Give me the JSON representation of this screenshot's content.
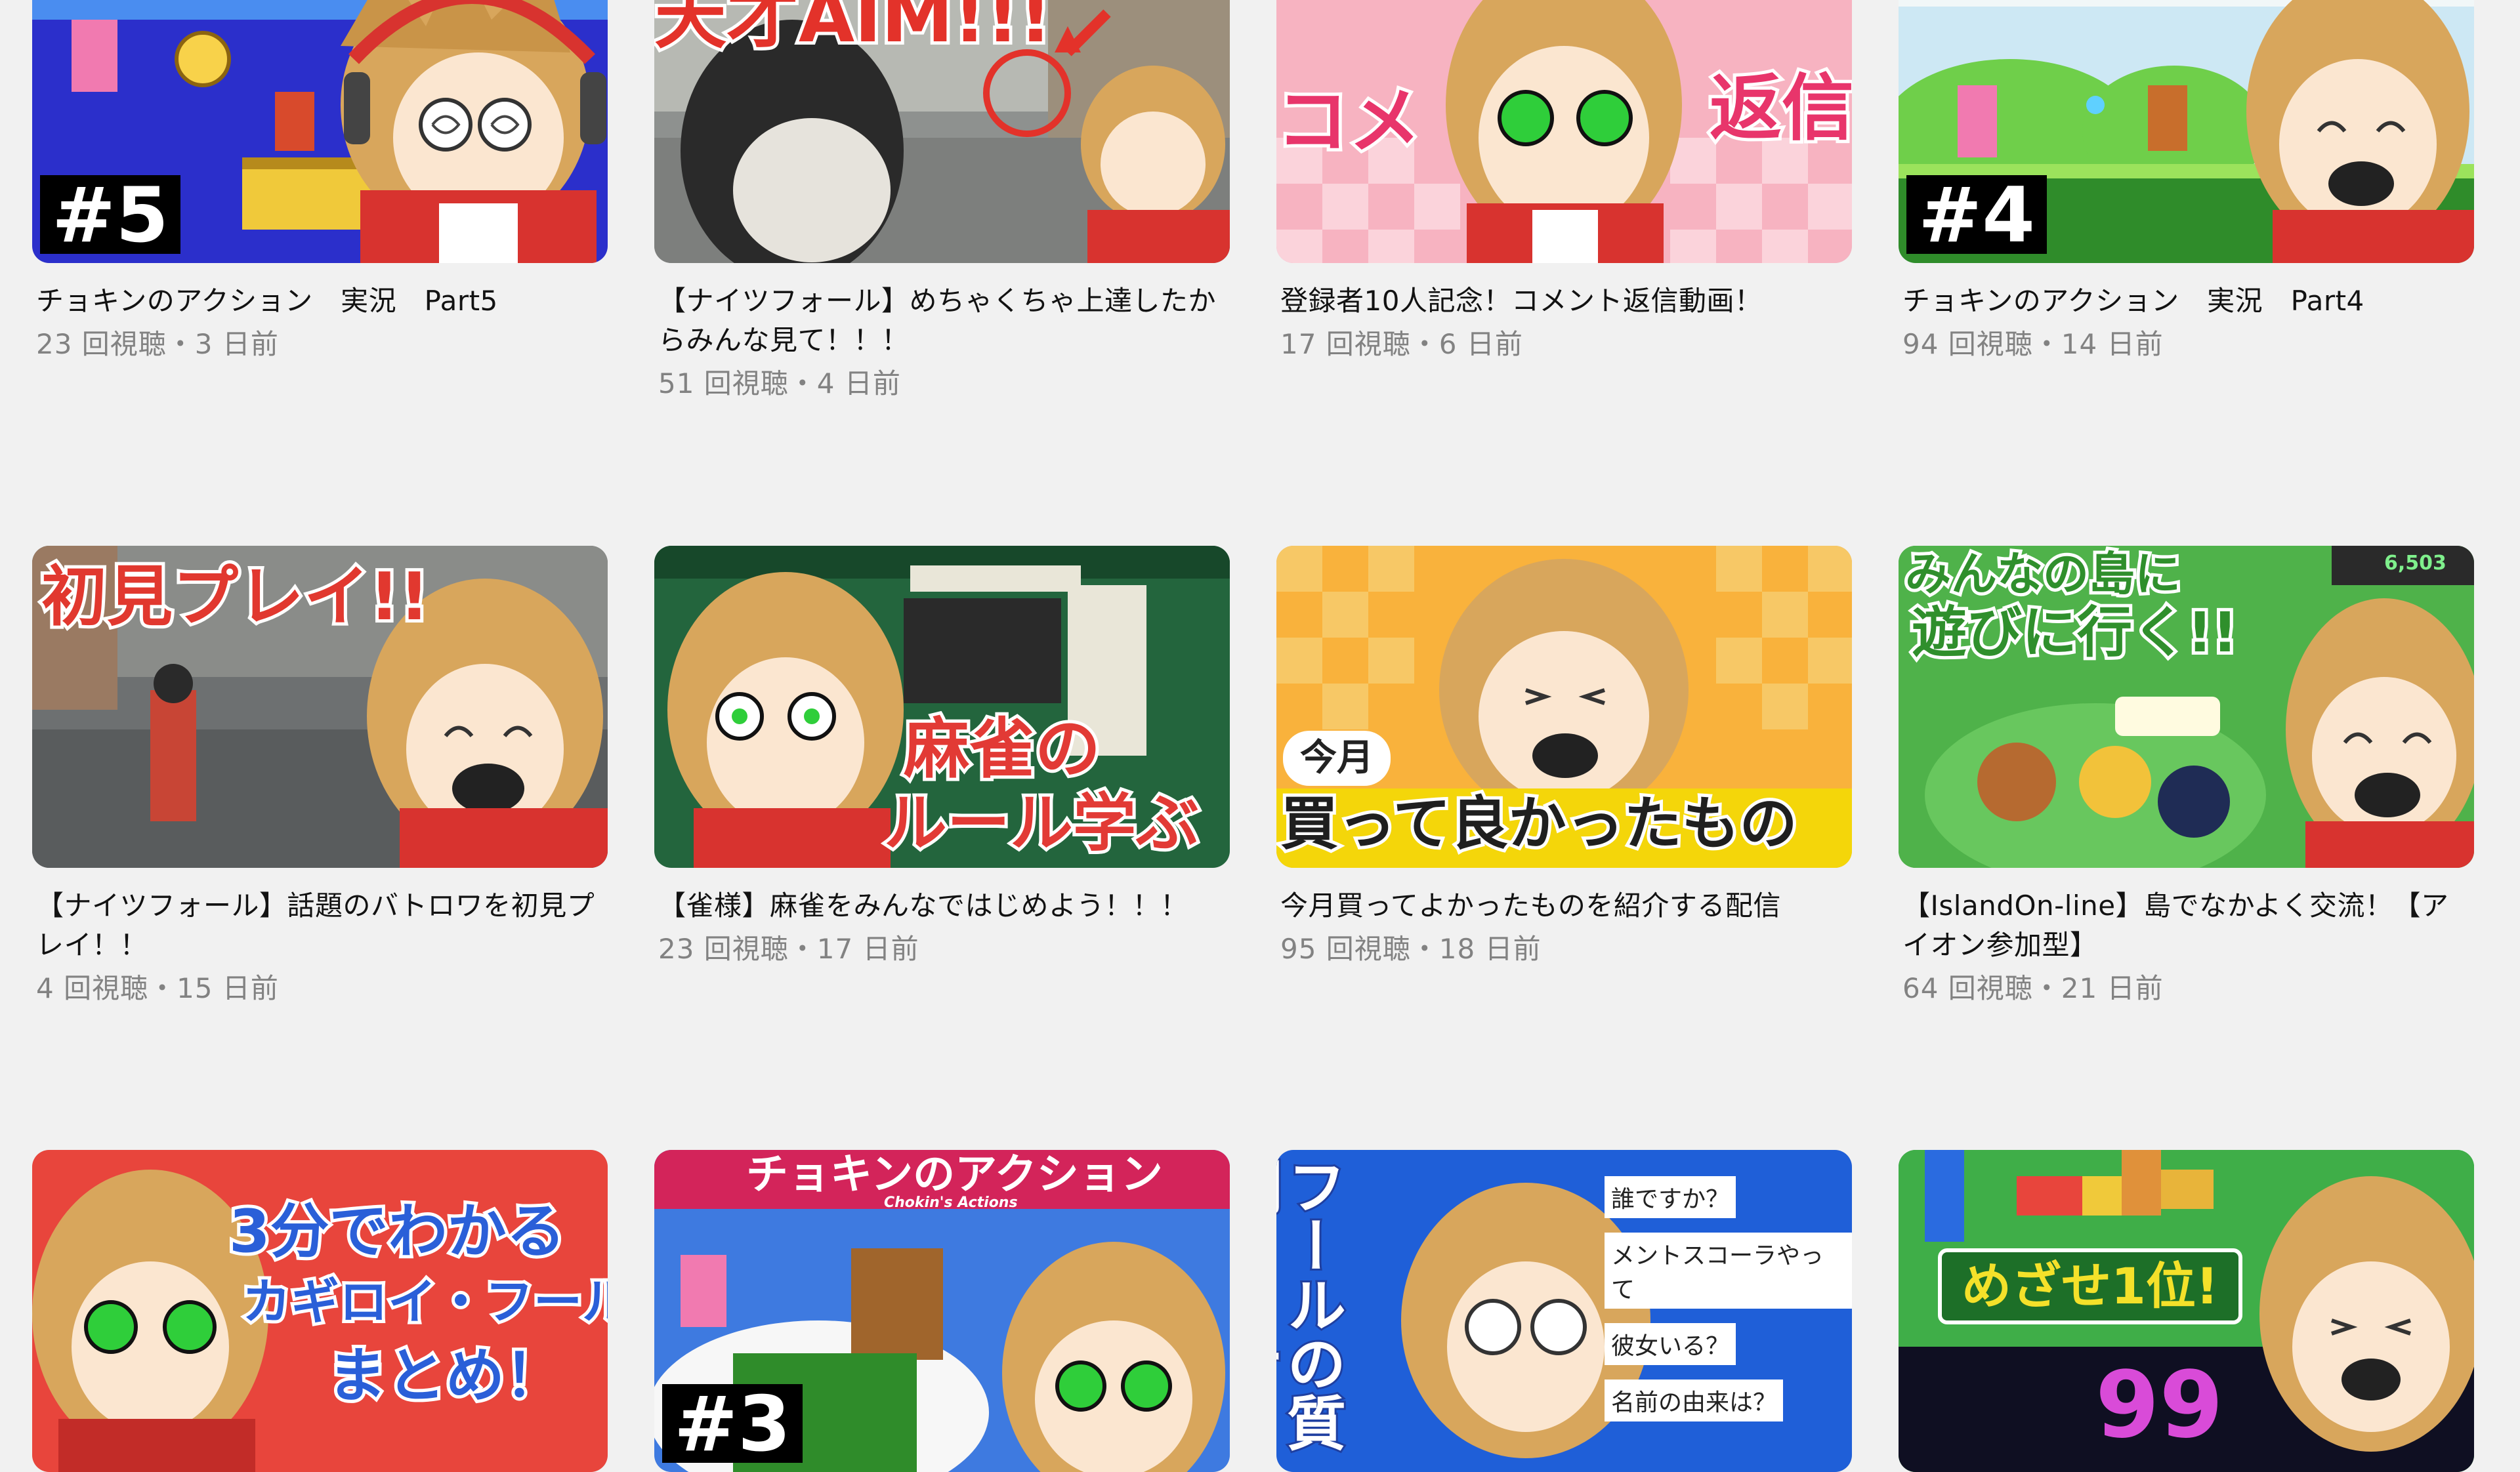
{
  "videos": [
    {
      "title": "チョキンのアクション　実況　Part5",
      "meta": "23 回視聴・3 日前",
      "thumb": {
        "style": "retro-blue",
        "badge": "#5",
        "colors": [
          "#3a3fd1",
          "#f0c93a",
          "#e8453c"
        ]
      }
    },
    {
      "title": "【ナイツフォール】めちゃくちゃ上達したからみんな見て！！！",
      "meta": "51 回視聴・4 日前",
      "thumb": {
        "style": "city-street",
        "overlay": "天才AIM!!!",
        "colors": [
          "#8d8f8c",
          "#e53a2f"
        ]
      }
    },
    {
      "title": "登録者10人記念！コメント返信動画！",
      "meta": "17 回視聴・6 日前",
      "thumb": {
        "style": "pink-check",
        "overlay_left": "コメ",
        "overlay_right": "返信",
        "colors": [
          "#f7a7b6",
          "#e8356b"
        ]
      }
    },
    {
      "title": "チョキンのアクション　実況　Part4",
      "meta": "94 回視聴・14 日前",
      "thumb": {
        "style": "retro-green",
        "badge": "#4",
        "colors": [
          "#6fcf4a",
          "#2f8c2a"
        ]
      }
    },
    {
      "title": "【ナイツフォール】話題のバトロワを初見プレイ！！",
      "meta": "4 回視聴・15 日前",
      "thumb": {
        "style": "city-gray",
        "overlay": "初見プレイ!!",
        "colors": [
          "#6b6e6f",
          "#e1382f"
        ]
      }
    },
    {
      "title": "【雀様】麻雀をみんなではじめよう！！！",
      "meta": "23 回視聴・17 日前",
      "thumb": {
        "style": "mahjong-green",
        "overlay_1": "麻雀の",
        "overlay_2": "ルール学ぶ",
        "colors": [
          "#23653d",
          "#e23a35"
        ]
      }
    },
    {
      "title": "今月買ってよかったものを紹介する配信",
      "meta": "95 回視聴・18 日前",
      "thumb": {
        "style": "orange-check",
        "bubble": "今月",
        "overlay": "買って良かったもの",
        "colors": [
          "#f9b23c",
          "#f4d60a"
        ]
      }
    },
    {
      "title": "【IslandOn-line】島でなかよく交流！【アイオン参加型】",
      "meta": "64 回視聴・21 日前",
      "thumb": {
        "style": "island",
        "overlay_1": "みんなの島に",
        "overlay_2": "遊びに行く!!",
        "counter": "6,503",
        "colors": [
          "#3a9e3a",
          "#ffffff"
        ]
      }
    },
    {
      "title": "",
      "meta": "",
      "thumb": {
        "style": "red-summary",
        "overlay_1": "3分でわかる",
        "overlay_2": "カギロイ・フール",
        "overlay_3": "まとめ！",
        "colors": [
          "#e8453c",
          "#2a5fd8"
        ]
      }
    },
    {
      "title": "",
      "meta": "",
      "thumb": {
        "style": "chokin-title",
        "overlay": "チョキンのアクション",
        "sub": "Chokin's Actions",
        "badge": "#3",
        "colors": [
          "#d3245a",
          "#3e7ae0"
        ]
      }
    },
    {
      "title": "",
      "meta": "",
      "thumb": {
        "style": "blue-qa",
        "vertical": "フールの質問コーナー",
        "questions": [
          "誰ですか？",
          "メントスコーラやって",
          "彼女いる？",
          "名前の由来は？"
        ],
        "colors": [
          "#1f5fd8",
          "#ffffff"
        ]
      }
    },
    {
      "title": "",
      "meta": "",
      "thumb": {
        "style": "puzzle",
        "overlay": "めざせ1位!",
        "logo": "99",
        "colors": [
          "#2f9c3b",
          "#e8453c"
        ]
      }
    }
  ]
}
